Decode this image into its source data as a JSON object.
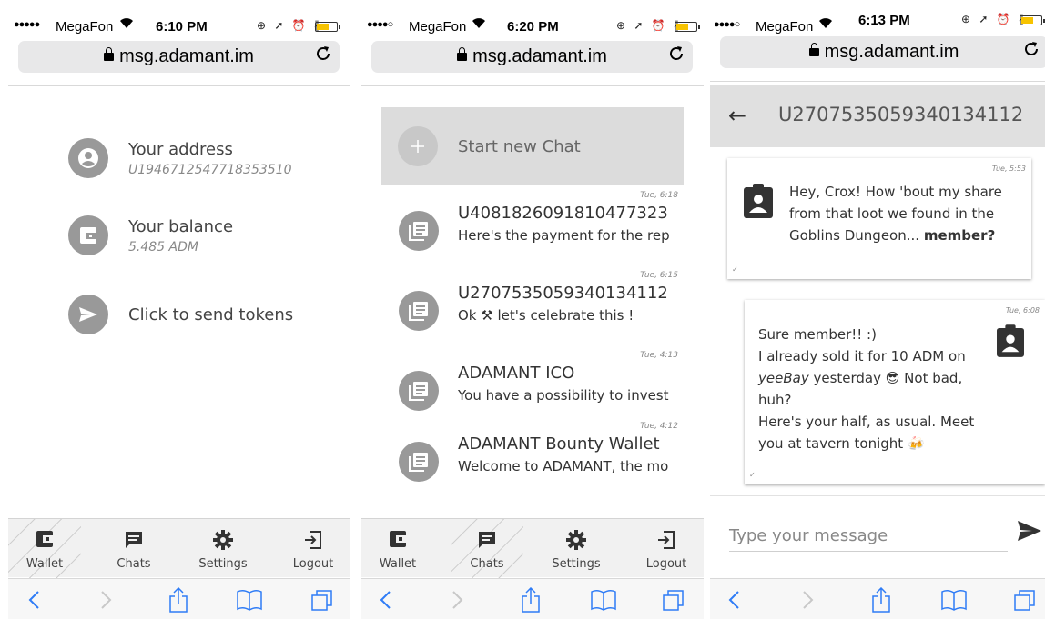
{
  "screens": [
    {
      "status": {
        "carrier": "MegaFon",
        "time": "6:10 PM"
      },
      "browser": {
        "url": "msg.adamant.im"
      },
      "wallet": {
        "address_label": "Your address",
        "address_value": "U1946712547718353510",
        "balance_label": "Your balance",
        "balance_value": "5.485 ADM",
        "send_label": "Click to send tokens"
      },
      "nav": {
        "wallet": "Wallet",
        "chats": "Chats",
        "settings": "Settings",
        "logout": "Logout",
        "active": "wallet"
      }
    },
    {
      "status": {
        "carrier": "MegaFon",
        "time": "6:20 PM"
      },
      "browser": {
        "url": "msg.adamant.im"
      },
      "chat_list": {
        "new_chat_label": "Start new Chat",
        "items": [
          {
            "time": "Tue, 6:18",
            "name": "U4081826091810477323",
            "preview": "Here's the payment for the rep"
          },
          {
            "time": "Tue, 6:15",
            "name": "U2707535059340134112",
            "preview": "Ok ⚒ let's celebrate this !"
          },
          {
            "time": "Tue, 4:13",
            "name": "ADAMANT ICO",
            "preview": "You have a possibility to invest"
          },
          {
            "time": "Tue, 4:12",
            "name": "ADAMANT Bounty Wallet",
            "preview": "Welcome to ADAMANT, the mo"
          }
        ]
      },
      "nav": {
        "wallet": "Wallet",
        "chats": "Chats",
        "settings": "Settings",
        "logout": "Logout",
        "active": "chats"
      }
    },
    {
      "status": {
        "carrier": "MegaFon",
        "time": "6:13 PM"
      },
      "browser": {
        "url": "msg.adamant.im"
      },
      "conversation": {
        "title": "U2707535059340134112",
        "messages": [
          {
            "time": "Tue, 5:53",
            "line1": "Hey, Crox! How 'bout my share",
            "line2": "from that loot we found in the",
            "line3_plain": "Goblins Dungeon... ",
            "line3_bold": "member?"
          },
          {
            "time": "Tue, 6:08",
            "line1": "Sure member!! :)",
            "line2": "I already sold it for 10 ADM on",
            "line3_italic": "yeeBay",
            "line3_rest1": " yesterday ",
            "line3_emoji": "😎",
            "line3_rest2": " Not bad,",
            "line4": "huh?",
            "line5": "Here's your half, as usual. Meet",
            "line6": "you at tavern tonight ",
            "line6_emoji": "🍻"
          }
        ],
        "input_placeholder": "Type your message"
      }
    }
  ],
  "icons": {
    "accent_gray": "#999999",
    "battery_yellow": "#f7c300"
  }
}
